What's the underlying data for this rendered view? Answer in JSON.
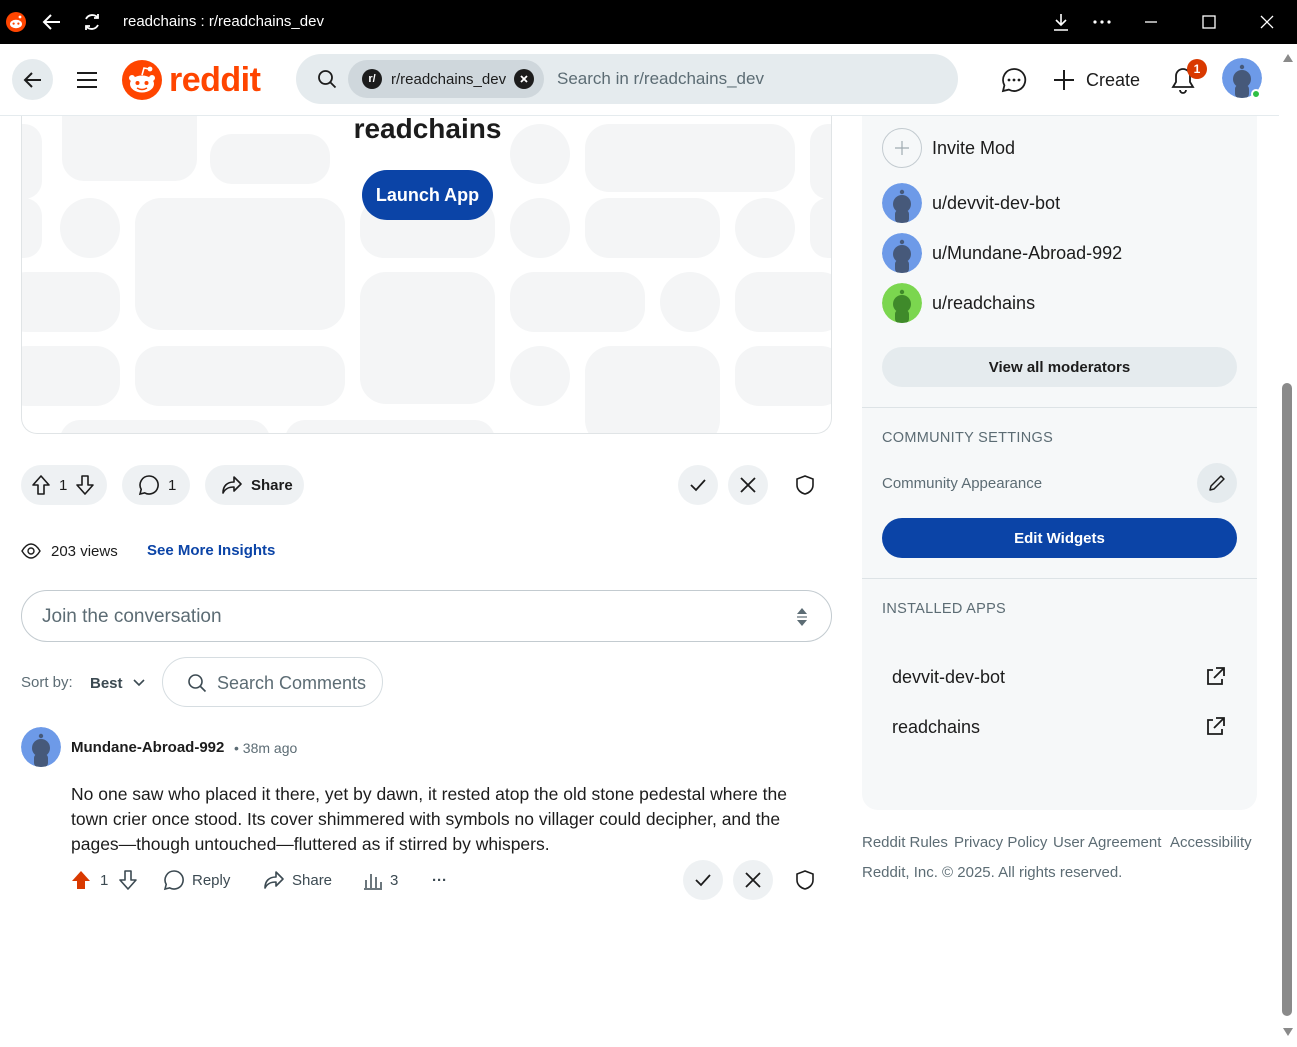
{
  "window": {
    "title": "readchains : r/readchains_dev"
  },
  "header": {
    "logo_text": "reddit",
    "search_chip_icon": "r/",
    "search_chip": "r/readchains_dev",
    "search_placeholder": "Search in r/readchains_dev",
    "create_label": "Create",
    "notification_count": "1"
  },
  "post": {
    "app_title": "readchains",
    "launch_label": "Launch App",
    "vote_count": "1",
    "comment_count": "1",
    "share_label": "Share",
    "views": "203 views",
    "insights_label": "See More Insights"
  },
  "comments": {
    "join_placeholder": "Join the conversation",
    "sort_label": "Sort by:",
    "sort_value": "Best",
    "search_placeholder": "Search Comments",
    "items": [
      {
        "author": "Mundane-Abroad-992",
        "time": "• 38m ago",
        "body": "No one saw who placed it there, yet by dawn, it rested atop the old stone pedestal where the town crier once stood. Its cover shimmered with symbols no villager could decipher, and the pages—though untouched—fluttered as if stirred by whispers.",
        "votes": "1",
        "reply_label": "Reply",
        "share_label": "Share",
        "insights_count": "3",
        "more_label": "···"
      }
    ]
  },
  "sidebar": {
    "invite_mod": "Invite Mod",
    "moderators": [
      "u/devvit-dev-bot",
      "u/Mundane-Abroad-992",
      "u/readchains"
    ],
    "view_all_mods": "View all moderators",
    "community_settings_title": "COMMUNITY SETTINGS",
    "community_appearance": "Community Appearance",
    "edit_widgets": "Edit Widgets",
    "installed_apps_title": "INSTALLED APPS",
    "apps": [
      "devvit-dev-bot",
      "readchains"
    ]
  },
  "footer": {
    "links": [
      "Reddit Rules",
      "Privacy Policy",
      "User Agreement",
      "Accessibility"
    ],
    "copyright": "Reddit, Inc. © 2025. All rights reserved."
  },
  "colors": {
    "brand": "#ff4500",
    "primary_button": "#0b44a7",
    "upvoted": "#d93900"
  }
}
